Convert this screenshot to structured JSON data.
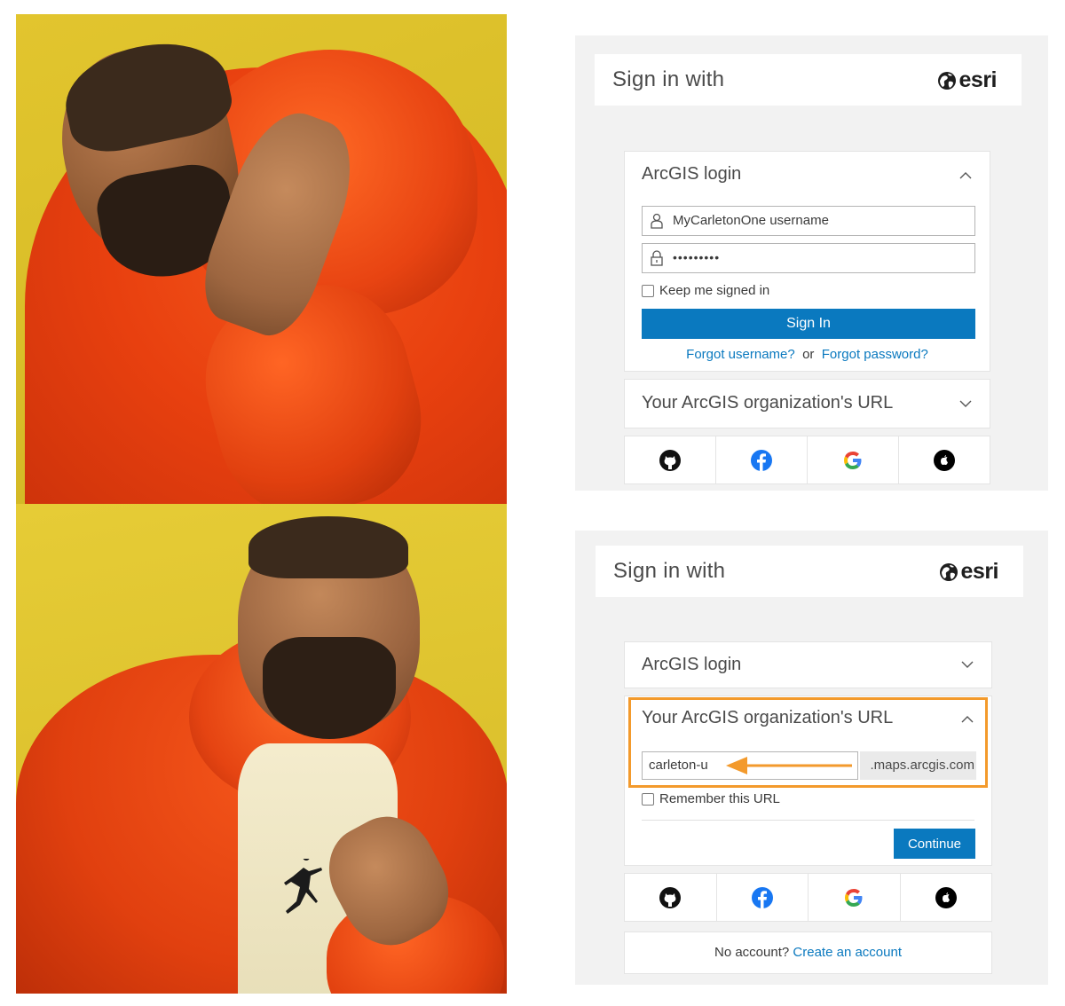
{
  "colors": {
    "accent": "#0a79bf",
    "highlight": "#f39a2c",
    "panel_bg": "#f2f2f2"
  },
  "meme": {
    "top_panel": {
      "icon": "person-rejecting-image"
    },
    "bottom_panel": {
      "icon": "person-approving-image"
    }
  },
  "login_before": {
    "header": {
      "title": "Sign in with",
      "brand": "esri"
    },
    "arcgis_login": {
      "title": "ArcGIS login",
      "expanded": true,
      "username_value": "MyCarletonOne username",
      "password_value": "•••••••••",
      "keep_signed_in_label": "Keep me signed in",
      "sign_in_label": "Sign In",
      "forgot_username": "Forgot username?",
      "or_text": "or",
      "forgot_password": "Forgot password?"
    },
    "org_url": {
      "title": "Your ArcGIS organization's URL",
      "expanded": false
    },
    "social_icons": [
      "github-icon",
      "facebook-icon",
      "google-icon",
      "apple-icon"
    ]
  },
  "login_after": {
    "header": {
      "title": "Sign in with",
      "brand": "esri"
    },
    "arcgis_login": {
      "title": "ArcGIS login",
      "expanded": false
    },
    "org_url": {
      "title": "Your ArcGIS organization's URL",
      "expanded": true,
      "input_value": "carleton-u",
      "suffix": ".maps.arcgis.com",
      "remember_label": "Remember this URL",
      "continue_label": "Continue"
    },
    "social_icons": [
      "github-icon",
      "facebook-icon",
      "google-icon",
      "apple-icon"
    ],
    "footer": {
      "no_account_text": "No account?",
      "create_account_link": "Create an account"
    }
  }
}
